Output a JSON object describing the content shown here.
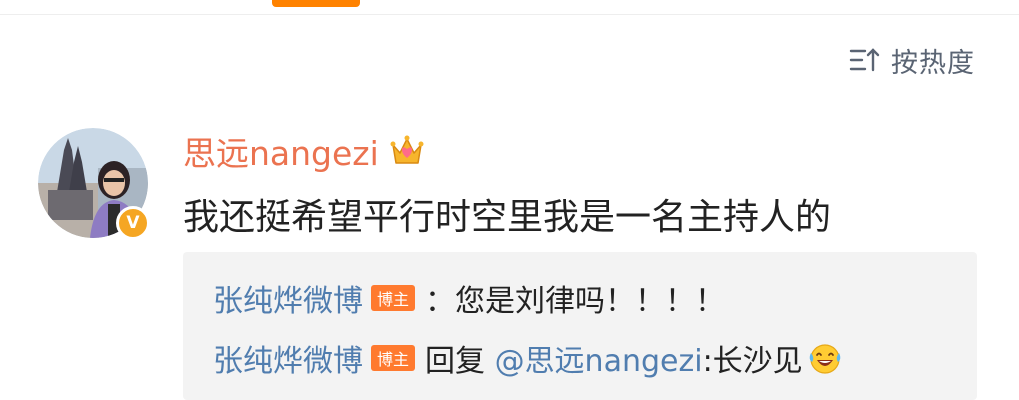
{
  "header": {
    "sort_label": "按热度",
    "sort_icon": "sort-icon",
    "active_tab_color": "#ff8200"
  },
  "comment": {
    "username": "思远nangezi",
    "username_color": "#eb7350",
    "crown_icon": "crown-icon",
    "verified_badge_text": "V",
    "text": "我还挺希望平行时空里我是一名主持人的"
  },
  "replies": [
    {
      "user": "张纯烨微博",
      "badge": "博主",
      "text": "：您是刘律吗！！！！"
    },
    {
      "user": "张纯烨微博",
      "badge": "博主",
      "prefix": "回复 ",
      "mention": "@思远nangezi",
      "text": ":长沙见",
      "emoji": "laugh-cry-emoji"
    }
  ],
  "colors": {
    "link_blue": "#507daf",
    "badge_orange": "#ff7a2f",
    "reply_bg": "#f3f3f3"
  }
}
